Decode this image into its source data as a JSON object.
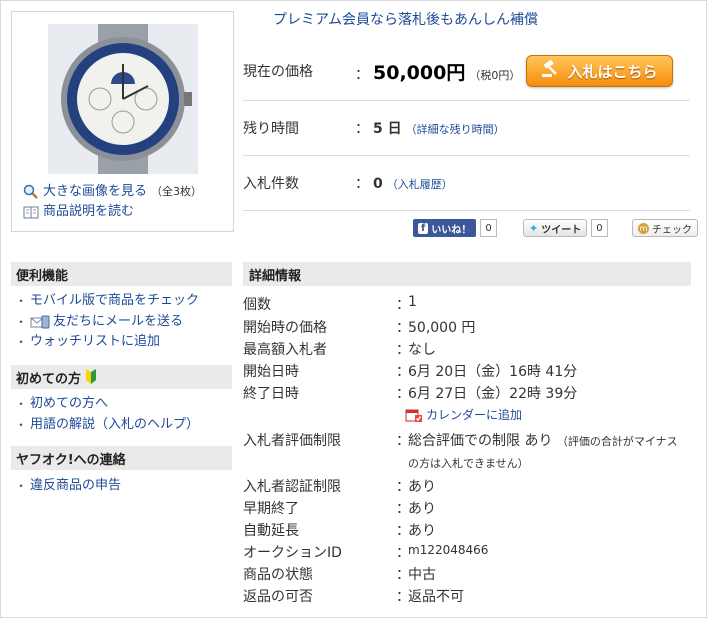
{
  "image_links": {
    "enlarge": "大きな画像を見る",
    "enlarge_count": "（全3枚）",
    "description": "商品説明を読む"
  },
  "premium": "プレミアム会員なら落札後もあんしん補償",
  "price": {
    "current_label": "現在の価格",
    "current_value": "50,000円",
    "tax": "（税0円）",
    "bid_button": "入札はこちら",
    "remaining_label": "残り時間",
    "remaining_value": "5 日",
    "remaining_link": "（詳細な残り時間）",
    "bids_label": "入札件数",
    "bids_value": "0",
    "bids_link": "（入札履歴）"
  },
  "social": {
    "like": "いいね！",
    "like_count": "0",
    "tweet": "ツイート",
    "tweet_count": "0",
    "check": "チェック"
  },
  "sidebar": {
    "convenient": {
      "title": "便利機能",
      "items": [
        "モバイル版で商品をチェック",
        "友だちにメールを送る",
        "ウォッチリストに追加"
      ]
    },
    "first_time": {
      "title": "初めての方",
      "items": [
        "初めての方へ",
        "用語の解説（入札のヘルプ）"
      ]
    },
    "contact": {
      "title": "ヤフオク!への連絡",
      "items": [
        "違反商品の申告"
      ]
    }
  },
  "details": {
    "title": "詳細情報",
    "rows": [
      {
        "label": "個数",
        "value": "1"
      },
      {
        "label": "開始時の価格",
        "value": "50,000 円"
      },
      {
        "label": "最高額入札者",
        "value": "なし"
      },
      {
        "label": "開始日時",
        "value": "6月 20日（金）16時 41分"
      },
      {
        "label": "終了日時",
        "value": "6月 27日（金）22時 39分"
      },
      {
        "label": "入札者評価制限",
        "value": "総合評価での制限 あり"
      },
      {
        "label": "入札者認証制限",
        "value": "あり"
      },
      {
        "label": "早期終了",
        "value": "あり"
      },
      {
        "label": "自動延長",
        "value": "あり"
      },
      {
        "label": "オークションID",
        "value": "m122048466"
      },
      {
        "label": "商品の状態",
        "value": "中古"
      },
      {
        "label": "返品の可否",
        "value": "返品不可"
      }
    ],
    "calendar_link": "カレンダーに追加",
    "rating_note_1": "（評価の合計がマイナス",
    "rating_note_2": "の方は入札できません）"
  },
  "colors": {
    "link": "#1d4a99",
    "bid_button": "#f58d0c",
    "panel_header": "#eaeaea"
  }
}
